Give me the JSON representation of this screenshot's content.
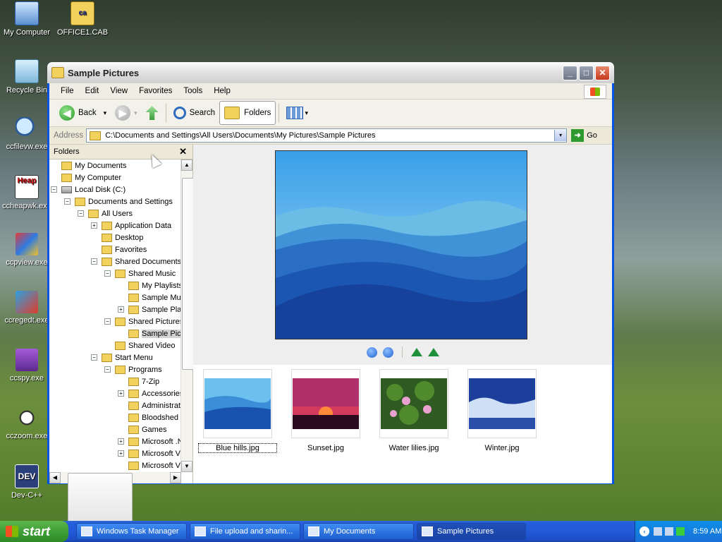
{
  "desktop": {
    "icons": [
      {
        "label": "My Computer"
      },
      {
        "label": "OFFICE1.CAB"
      },
      {
        "label": "Recycle Bin"
      },
      {
        "label": "ccfilevw.exe"
      },
      {
        "label": "ccheapwk.exe"
      },
      {
        "label": "ccpview.exe"
      },
      {
        "label": "ccregedt.exe"
      },
      {
        "label": "ccspy.exe"
      },
      {
        "label": "cczoom.exe"
      },
      {
        "label": "Dev-C++"
      }
    ],
    "cab_glyph": "ca",
    "heap_glyph": "Heap",
    "dev_glyph": "DEV"
  },
  "window": {
    "title": "Sample Pictures",
    "min_glyph": "_",
    "max_glyph": "□",
    "close_glyph": "✕"
  },
  "menubar": {
    "items": [
      "File",
      "Edit",
      "View",
      "Favorites",
      "Tools",
      "Help"
    ]
  },
  "toolbar": {
    "back_label": "Back",
    "search_label": "Search",
    "folders_label": "Folders",
    "back_glyph": "◀",
    "forward_glyph": "▶",
    "dropdown_glyph": "▾"
  },
  "address": {
    "label": "Address",
    "value": "C:\\Documents and Settings\\All Users\\Documents\\My Pictures\\Sample Pictures",
    "go_label": "Go",
    "go_glyph": "➜",
    "dropdown_glyph": "▾"
  },
  "folders_pane": {
    "header": "Folders",
    "close_glyph": "✕",
    "tree": [
      {
        "label": "My Documents",
        "level": 0,
        "expander": "",
        "icon": "folder"
      },
      {
        "label": "My Computer",
        "level": 0,
        "expander": "",
        "icon": "computer"
      },
      {
        "label": "Local Disk (C:)",
        "level": 0,
        "expander": "−",
        "icon": "disk"
      },
      {
        "label": "Documents and Settings",
        "level": 1,
        "expander": "−",
        "icon": "folder"
      },
      {
        "label": "All Users",
        "level": 2,
        "expander": "−",
        "icon": "folder"
      },
      {
        "label": "Application Data",
        "level": 3,
        "expander": "+",
        "icon": "folder"
      },
      {
        "label": "Desktop",
        "level": 3,
        "expander": "",
        "icon": "folder"
      },
      {
        "label": "Favorites",
        "level": 3,
        "expander": "",
        "icon": "folder"
      },
      {
        "label": "Shared Documents",
        "level": 3,
        "expander": "−",
        "icon": "folder"
      },
      {
        "label": "Shared Music",
        "level": 4,
        "expander": "−",
        "icon": "folder"
      },
      {
        "label": "My Playlists",
        "level": 5,
        "expander": "",
        "icon": "folder"
      },
      {
        "label": "Sample Mus",
        "level": 5,
        "expander": "",
        "icon": "folder"
      },
      {
        "label": "Sample Play",
        "level": 5,
        "expander": "+",
        "icon": "folder"
      },
      {
        "label": "Shared Pictures",
        "level": 4,
        "expander": "−",
        "icon": "folder"
      },
      {
        "label": "Sample Pictu",
        "level": 5,
        "expander": "",
        "icon": "folder",
        "selected": true
      },
      {
        "label": "Shared Video",
        "level": 4,
        "expander": "",
        "icon": "folder"
      },
      {
        "label": "Start Menu",
        "level": 3,
        "expander": "−",
        "icon": "folder"
      },
      {
        "label": "Programs",
        "level": 4,
        "expander": "−",
        "icon": "folder"
      },
      {
        "label": "7-Zip",
        "level": 5,
        "expander": "",
        "icon": "folder"
      },
      {
        "label": "Accessories",
        "level": 5,
        "expander": "+",
        "icon": "folder"
      },
      {
        "label": "Administrati",
        "level": 5,
        "expander": "",
        "icon": "folder"
      },
      {
        "label": "Bloodshed D",
        "level": 5,
        "expander": "",
        "icon": "folder"
      },
      {
        "label": "Games",
        "level": 5,
        "expander": "",
        "icon": "folder"
      },
      {
        "label": "Microsoft .N",
        "level": 5,
        "expander": "+",
        "icon": "folder"
      },
      {
        "label": "Microsoft Vi",
        "level": 5,
        "expander": "+",
        "icon": "folder"
      },
      {
        "label": "Microsoft Vi",
        "level": 5,
        "expander": "",
        "icon": "folder"
      }
    ],
    "up_glyph": "▲",
    "down_glyph": "▼",
    "left_glyph": "◀",
    "right_glyph": "▶"
  },
  "preview": {
    "image_name": "Blue hills.jpg"
  },
  "thumbnails": [
    {
      "label": "Blue hills.jpg",
      "focused": true
    },
    {
      "label": "Sunset.jpg",
      "focused": false
    },
    {
      "label": "Water lilies.jpg",
      "focused": false
    },
    {
      "label": "Winter.jpg",
      "focused": false
    }
  ],
  "taskbar": {
    "start_label": "start",
    "tasks": [
      {
        "label": "Windows Task Manager",
        "active": false
      },
      {
        "label": "File upload and sharin...",
        "active": false
      },
      {
        "label": "My Documents",
        "active": false
      },
      {
        "label": "Sample Pictures",
        "active": true
      }
    ],
    "tray_chevron": "‹",
    "clock": "8:59 AM"
  }
}
